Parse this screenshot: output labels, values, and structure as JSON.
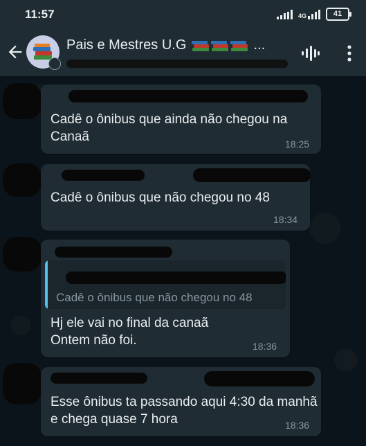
{
  "status_bar": {
    "time": "11:57",
    "network": "4G",
    "battery": "41"
  },
  "header": {
    "group_name": "Pais e Mestres U.G",
    "title_suffix": "..."
  },
  "messages": [
    {
      "text": "Cadê o ônibus que ainda não chegou na Canaã",
      "time": "18:25"
    },
    {
      "text": "Cadê o ônibus que não chegou no 48",
      "time": "18:34"
    },
    {
      "quoted_text": "Cadê o ônibus que não chegou no 48",
      "text": "Hj ele vai no final da canaã\nOntem não foi.",
      "time": "18:36"
    },
    {
      "text": "Esse ônibus ta passando aqui 4:30 da manhã e chega quase 7 hora",
      "time": "18:36"
    }
  ],
  "colors": {
    "background": "#0b141a",
    "bar": "#1f2c34",
    "bubble": "#1f2c34",
    "quote_accent": "#53bdeb",
    "meta_text": "#8696a0"
  }
}
